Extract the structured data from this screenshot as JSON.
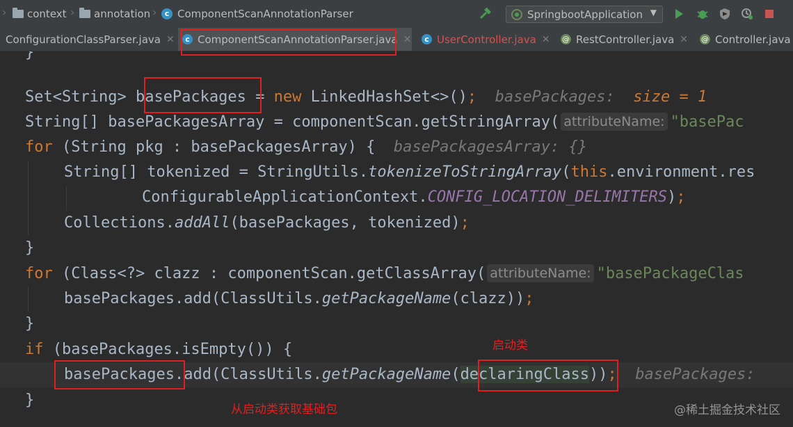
{
  "breadcrumb": {
    "items": [
      "context",
      "annotation",
      "ComponentScanAnnotationParser"
    ]
  },
  "toolbar": {
    "run_config": "SpringbootApplication",
    "icons": [
      "hammer-icon",
      "run-icon",
      "debug-icon",
      "coverage-icon",
      "profile-icon",
      "stop-icon"
    ],
    "colors": {
      "run": "#499c54",
      "stop": "#c75450"
    }
  },
  "tabs": [
    {
      "label": "ConfigurationClassParser.java",
      "active": false
    },
    {
      "label": "ComponentScanAnnotationParser.java",
      "active": true
    },
    {
      "label": "UserController.java",
      "active": false
    },
    {
      "label": "RestController.java",
      "active": false
    },
    {
      "label": "Controller.java",
      "active": false
    }
  ],
  "code": {
    "l_brace_top": "}",
    "l1": {
      "type": "Set<String> ",
      "var": "basePackages",
      "assign": " = ",
      "new": "new",
      "ctor": " LinkedHashSet<>()",
      "semi": ";",
      "dbg_name": "basePackages:",
      "dbg_val": "size = 1"
    },
    "l2": {
      "type": "String[] basePackagesArray = componentScan.getStringArray(",
      "hint": "attributeName:",
      "arg": "\"basePac"
    },
    "l3": {
      "kw": "for",
      "rest": " (String pkg : basePackagesArray) {",
      "dbg": "basePackagesArray: {}"
    },
    "l4": {
      "pre": "String[] tokenized = StringUtils.",
      "method": "tokenizeToStringArray",
      "open": "(",
      "this": "this",
      "rest": ".environment.res"
    },
    "l5": {
      "pre": "ConfigurableApplicationContext.",
      "field": "CONFIG_LOCATION_DELIMITERS",
      "close": ")",
      "semi": ";"
    },
    "l6": {
      "pre": "Collections.",
      "method": "addAll",
      "args": "(basePackages, tokenized)",
      "semi": ";"
    },
    "l7": "}",
    "l8": {
      "kw": "for",
      "rest": " (Class<?> clazz : componentScan.getClassArray(",
      "hint": "attributeName:",
      "arg": "\"basePackageClas"
    },
    "l9": {
      "pre": "basePackages.add(ClassUtils.",
      "method": "getPackageName",
      "args": "(clazz))",
      "semi": ";"
    },
    "l10": "}",
    "l11": {
      "kw": "if",
      "rest": " (basePackages.isEmpty()) {"
    },
    "l12": {
      "var": "basePackages",
      "pre": ".add(ClassUtils.",
      "method": "getPackageName",
      "open": "(",
      "arg": "declaringClass",
      "close": "))",
      "semi": ";",
      "dbg": "basePackages:"
    },
    "l13": "}"
  },
  "annotations": {
    "boot_class": "启动类",
    "get_base_package": "从启动类获取基础包"
  },
  "watermark": "@稀土掘金技术社区"
}
